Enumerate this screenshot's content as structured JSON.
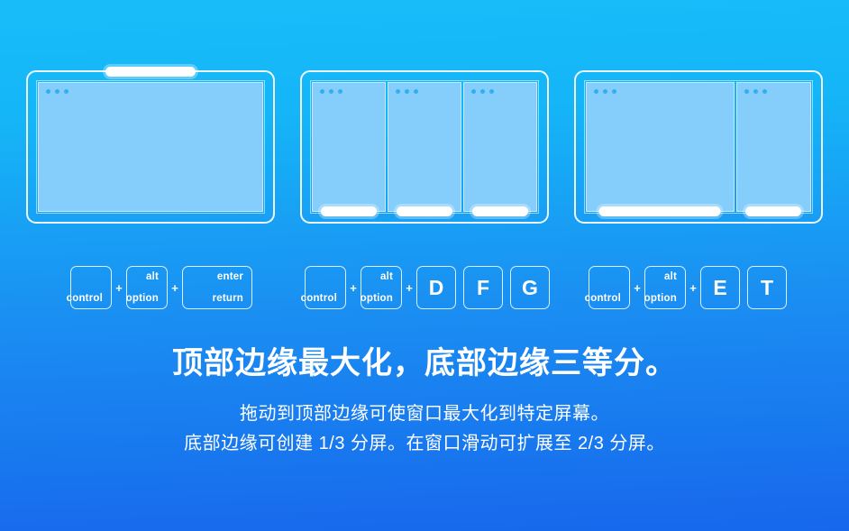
{
  "theme": {
    "bg_top": "#17bdf9",
    "bg_bottom": "#1767ec",
    "pane_fill": "#85cdfa",
    "accent_white": "#ffffff",
    "dot_color": "#2fb0ef"
  },
  "diagrams": [
    {
      "name": "maximize-top-edge",
      "grab_pill_position": "top",
      "panes": [
        {
          "layout": "full",
          "dots": 3
        }
      ]
    },
    {
      "name": "thirds-bottom-edge",
      "grab_pill_position": "bottom",
      "panes": [
        {
          "layout": "third",
          "dots": 3
        },
        {
          "layout": "third",
          "dots": 3
        },
        {
          "layout": "third",
          "dots": 3
        }
      ]
    },
    {
      "name": "two-thirds-bottom-edge",
      "grab_pill_position": "bottom",
      "panes": [
        {
          "layout": "twothird",
          "dots": 3
        },
        {
          "layout": "third",
          "dots": 3
        }
      ]
    }
  ],
  "shortcuts": [
    {
      "name": "maximize",
      "keys": [
        {
          "type": "modifier",
          "top": "",
          "bottom": "control",
          "width": "k-control"
        },
        {
          "type": "modifier",
          "top": "alt",
          "bottom": "option",
          "width": "k-option"
        },
        {
          "type": "modifier",
          "top": "enter",
          "bottom": "return",
          "width": "k-enter"
        }
      ],
      "separator": "+"
    },
    {
      "name": "thirds",
      "keys": [
        {
          "type": "modifier",
          "top": "",
          "bottom": "control",
          "width": "k-control"
        },
        {
          "type": "modifier",
          "top": "alt",
          "bottom": "option",
          "width": "k-option"
        },
        {
          "type": "letter",
          "label": "D"
        },
        {
          "type": "letter",
          "label": "F"
        },
        {
          "type": "letter",
          "label": "G"
        }
      ],
      "separator": "+"
    },
    {
      "name": "two-thirds",
      "keys": [
        {
          "type": "modifier",
          "top": "",
          "bottom": "control",
          "width": "k-control"
        },
        {
          "type": "modifier",
          "top": "alt",
          "bottom": "option",
          "width": "k-option"
        },
        {
          "type": "letter",
          "label": "E"
        },
        {
          "type": "letter",
          "label": "T"
        }
      ],
      "separator": "+"
    }
  ],
  "keys_literal": {
    "control": "control",
    "alt": "alt",
    "option": "option",
    "enter": "enter",
    "return": "return",
    "d": "D",
    "f": "F",
    "g": "G",
    "e": "E",
    "t": "T",
    "plus": "+"
  },
  "copy": {
    "headline": "顶部边缘最大化，底部边缘三等分。",
    "body_line_1": "拖动到顶部边缘可使窗口最大化到特定屏幕。",
    "body_line_2": "底部边缘可创建 1/3 分屏。在窗口滑动可扩展至 2/3 分屏。"
  }
}
